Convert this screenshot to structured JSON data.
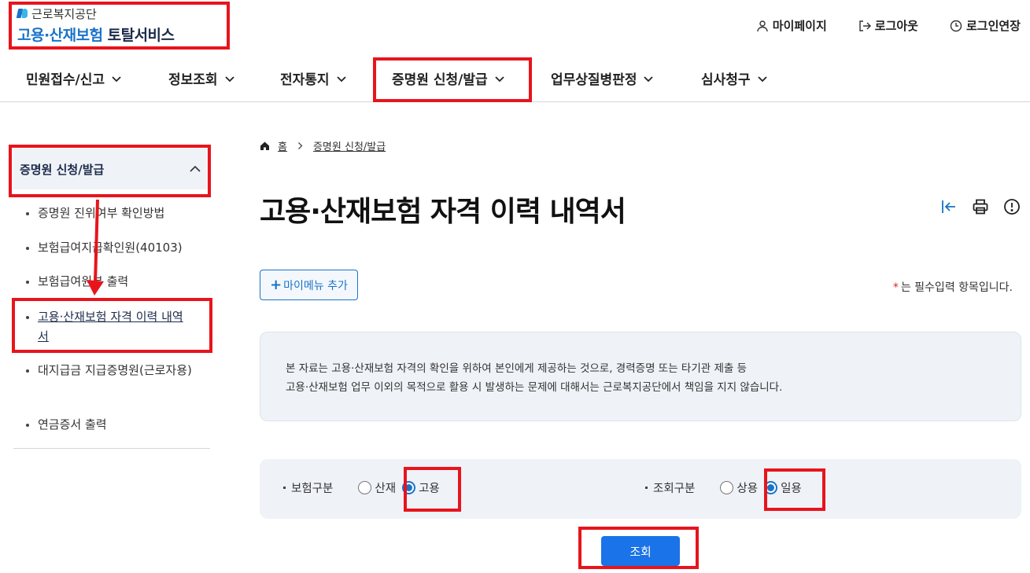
{
  "header": {
    "org_name": "근로복지공단",
    "service_name_a": "고용·산재보험",
    "service_name_b": "토탈서비스",
    "util": [
      {
        "label": "마이페이지",
        "icon": "user-icon"
      },
      {
        "label": "로그아웃",
        "icon": "logout-icon"
      },
      {
        "label": "로그인연장",
        "icon": "clock-icon"
      }
    ]
  },
  "gnb": {
    "items": [
      "민원접수/신고",
      "정보조회",
      "전자통지",
      "증명원 신청/발급",
      "업무상질병판정",
      "심사청구"
    ]
  },
  "sidebar": {
    "title": "증명원 신청/발급",
    "items": [
      "증명원 진위여부 확인방법",
      "보험급여지급확인원(40103)",
      "보험급여원부 출력",
      "고용·산재보험 자격 이력 내역서",
      "대지급금 지급증명원(근로자용)",
      "연금증서 출력"
    ],
    "active_index": 3
  },
  "breadcrumb": {
    "home": "홈",
    "current": "증명원 신청/발급"
  },
  "page": {
    "title": "고용·산재보험 자격 이력 내역서",
    "mymenu_label": "마이메뉴 추가",
    "required_note": "는 필수입력 항목입니다.",
    "notice_line1": "본 자료는 고용·산재보험 자격의 확인을 위하여 본인에게 제공하는 것으로, 경력증명 또는 타기관 제출 등",
    "notice_line2": "고용·산재보험 업무 이외의 목적으로 활용 시 발생하는 문제에 대해서는 근로복지공단에서 책임을 지지 않습니다."
  },
  "form": {
    "insurance": {
      "label": "보험구분",
      "options": [
        "산재",
        "고용"
      ],
      "selected": "고용"
    },
    "lookup": {
      "label": "조회구분",
      "options": [
        "상용",
        "일용"
      ],
      "selected": "일용"
    },
    "submit_label": "조회"
  },
  "colors": {
    "accent": "#1a73e8",
    "highlight": "#e8141c"
  }
}
